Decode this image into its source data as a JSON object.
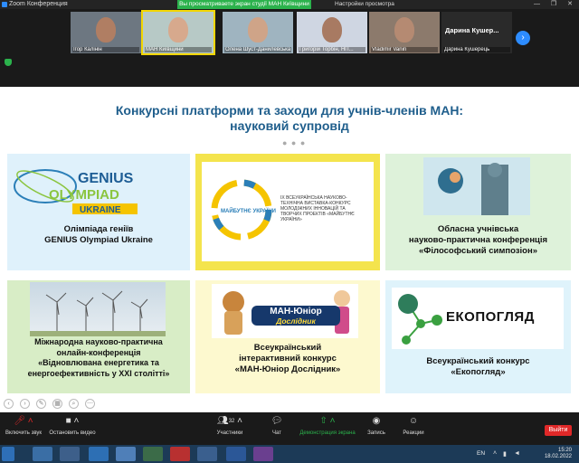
{
  "window": {
    "title": "Zoom Конференция",
    "share_banner": "Вы просматриваете экран студії МАН Київщини",
    "view_options": "Настройки просмотра",
    "controls": "— ❐ ✕"
  },
  "participants": [
    {
      "name": "Ігор Калінін",
      "bg": "#6d7781",
      "face": "#b07e63",
      "active": false
    },
    {
      "name": "МАН Київщини",
      "bg": "#b7c9c6",
      "face": "#d7a98d",
      "active": true
    },
    {
      "name": "Олена Шуст-Данилевська",
      "bg": "#9fb4c0",
      "face": "#cfa488",
      "active": false
    },
    {
      "name": "Григорій Торбін, НП...",
      "bg": "#cfd6e2",
      "face": "#a87a62",
      "active": false
    },
    {
      "name": "Vladimir Vanin",
      "bg": "#8c7a6c",
      "face": "#b58a72",
      "active": false
    },
    {
      "name": "Дарина Кушерець",
      "big_name": "Дарина  Кушер...",
      "bg": "#2a2a2a",
      "active": false
    }
  ],
  "slide": {
    "title_line1": "Конкурсні платформи та заходи для учнів-членів МАН:",
    "title_line2": "науковий супровід",
    "dots": "● ● ●",
    "cards": [
      {
        "logo_genius": "GENIUS",
        "logo_olympiad": "OLYMPIAD",
        "logo_ukraine": "UKRAINE",
        "line1": "Олімпіада геніїв",
        "line2": "GENIUS Olympiad Ukraine"
      },
      {
        "expo_text": "IX ВСЕУКРАЇНСЬКА НАУКОВО-ТЕХНІЧНА ВИСТАВКА-КОНКУРС МОЛОДІЖНИХ ІННОВАЦІЙ ТА ТВОРЧИХ ПРОЕКТІВ «МАЙБУТНЄ УКРАЇНИ»",
        "logo_text": "МАЙБУТНЄ УКРАЇНИ"
      },
      {
        "line1": "Обласна учнівська",
        "line2": "науково-практична  конференція",
        "line3": "«Філософський симпозіон»"
      },
      {
        "line1": "Міжнародна науково-практична",
        "line2": "онлайн-конференція",
        "line3": "«Відновлювана енергетика та",
        "line4": "енергоефективність у XXI столітті»"
      },
      {
        "logo_line1": "МАН-Юніор",
        "logo_line2": "Дослідник",
        "line1": "Всеукраїнський",
        "line2": "інтерактивний конкурс",
        "line3": "«МАН-Юніор Дослідник»"
      },
      {
        "logo_text": "ЕКОПОГЛЯД",
        "line1": "Всеукраїнський конкурс",
        "line2": "«Екопогляд»"
      }
    ]
  },
  "toolbar": {
    "mute": "Включить звук",
    "video": "Остановить видео",
    "participants": "Участники",
    "participants_count": "32",
    "chat": "Чат",
    "share": "Демонстрация экрана",
    "record": "Запись",
    "reactions": "Реакции",
    "end": "Выйти"
  },
  "taskbar": {
    "lang": "EN",
    "time": "15:20",
    "date": "18.02.2022"
  },
  "colors": {
    "title_blue": "#1f5e8c",
    "zoom_green": "#2bb24c",
    "zoom_blue": "#2d8cff",
    "end_red": "#e02828"
  }
}
